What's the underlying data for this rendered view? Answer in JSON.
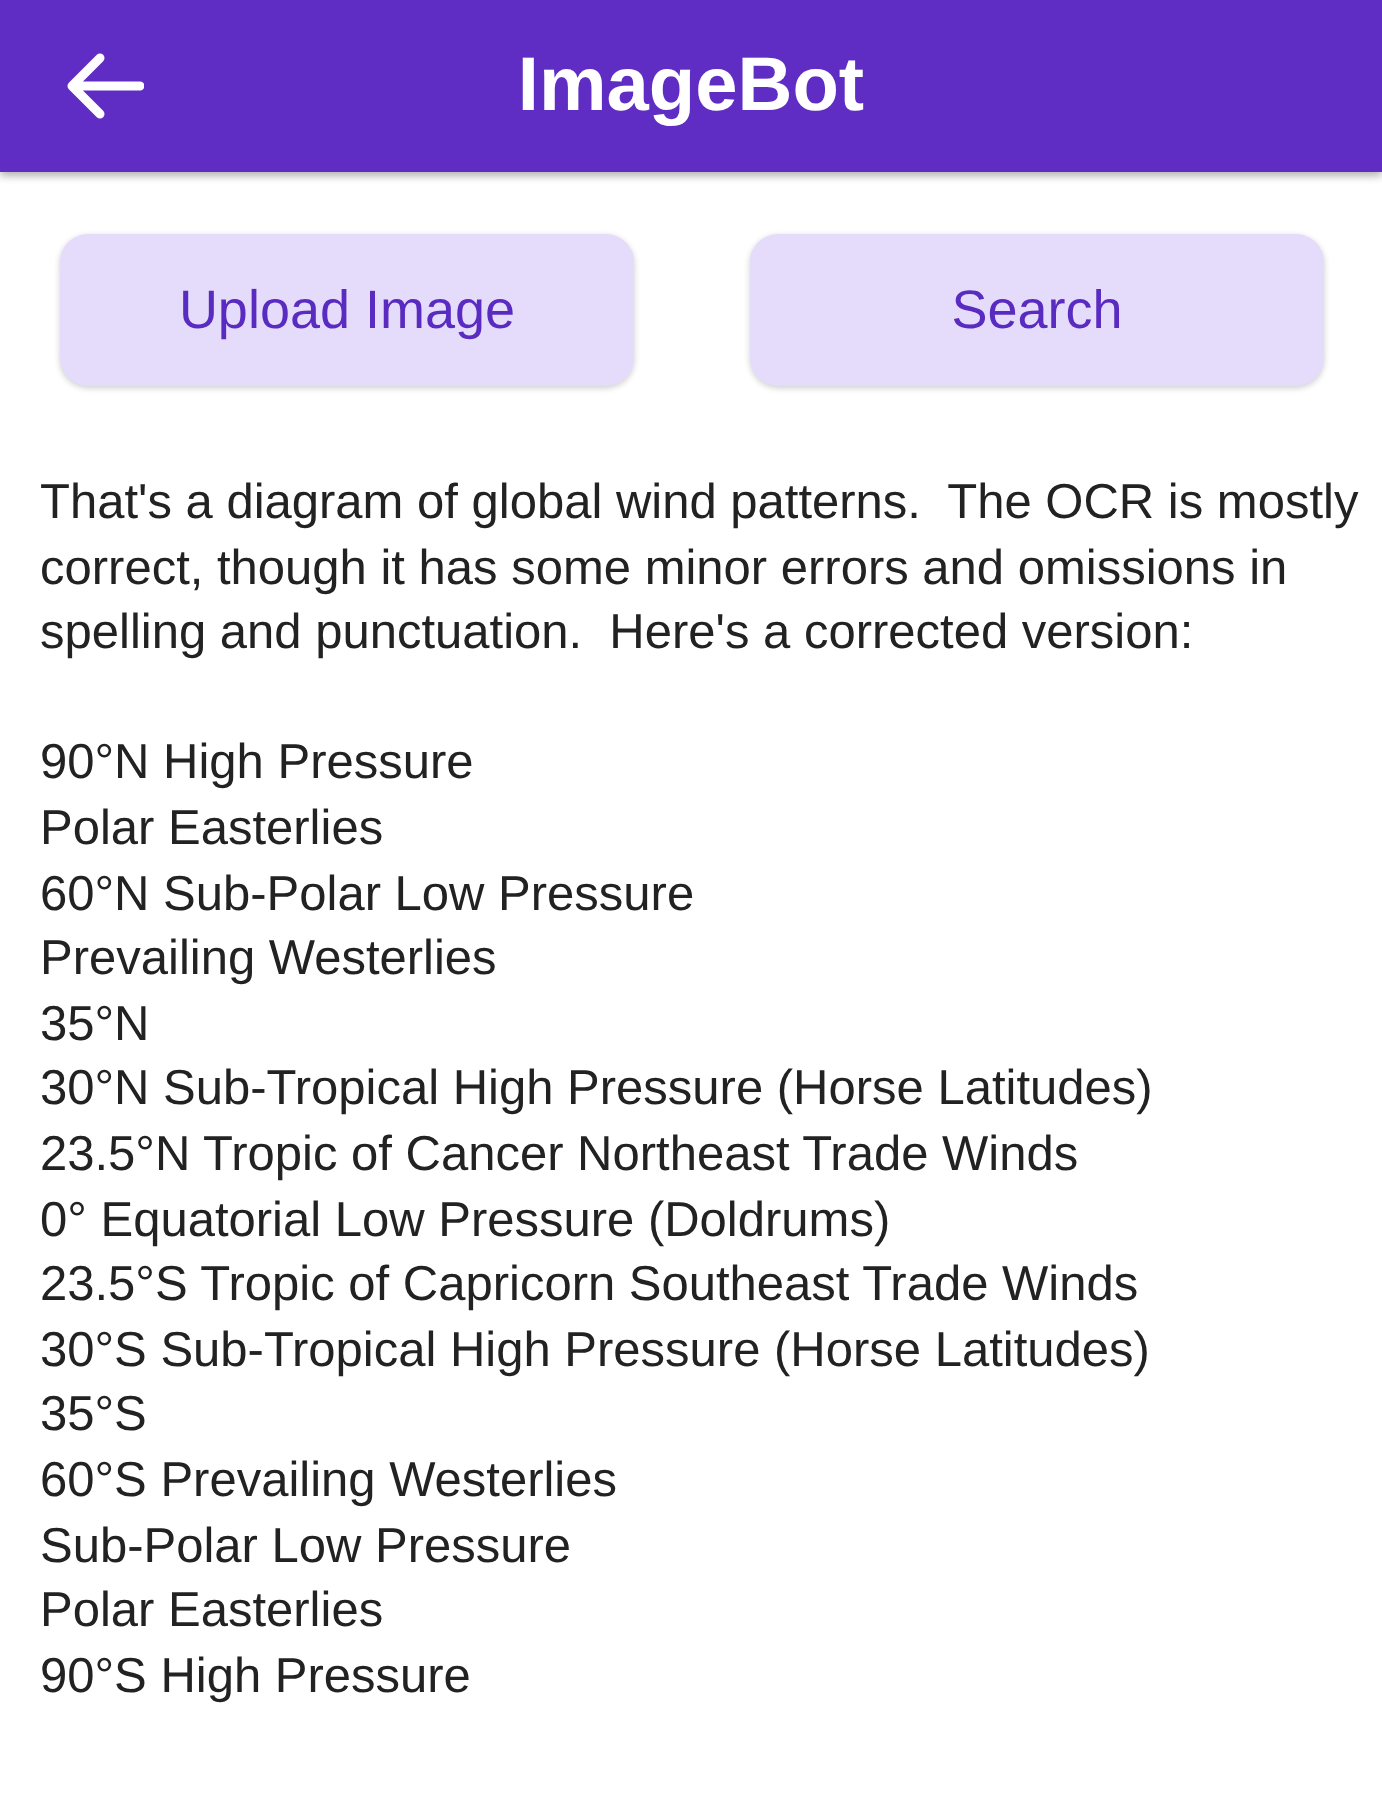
{
  "app_bar": {
    "title": "ImageBot"
  },
  "buttons": [
    {
      "label": "Upload Image"
    },
    {
      "label": "Search"
    }
  ],
  "response": {
    "paragraph": "That's a diagram of global wind patterns.  The OCR is mostly correct, though it has some minor errors and omissions in spelling and punctuation.  Here's a corrected version:",
    "lines": [
      "90°N High Pressure",
      "Polar Easterlies",
      "60°N Sub-Polar Low Pressure",
      "Prevailing Westerlies",
      "35°N",
      "30°N Sub-Tropical High Pressure (Horse Latitudes)",
      "23.5°N Tropic of Cancer Northeast Trade Winds",
      "0° Equatorial Low Pressure (Doldrums)",
      "23.5°S Tropic of Capricorn Southeast Trade Winds",
      "30°S Sub-Tropical High Pressure (Horse Latitudes)",
      "35°S",
      "60°S Prevailing Westerlies",
      "Sub-Polar Low Pressure",
      "Polar Easterlies",
      "90°S High Pressure"
    ]
  }
}
